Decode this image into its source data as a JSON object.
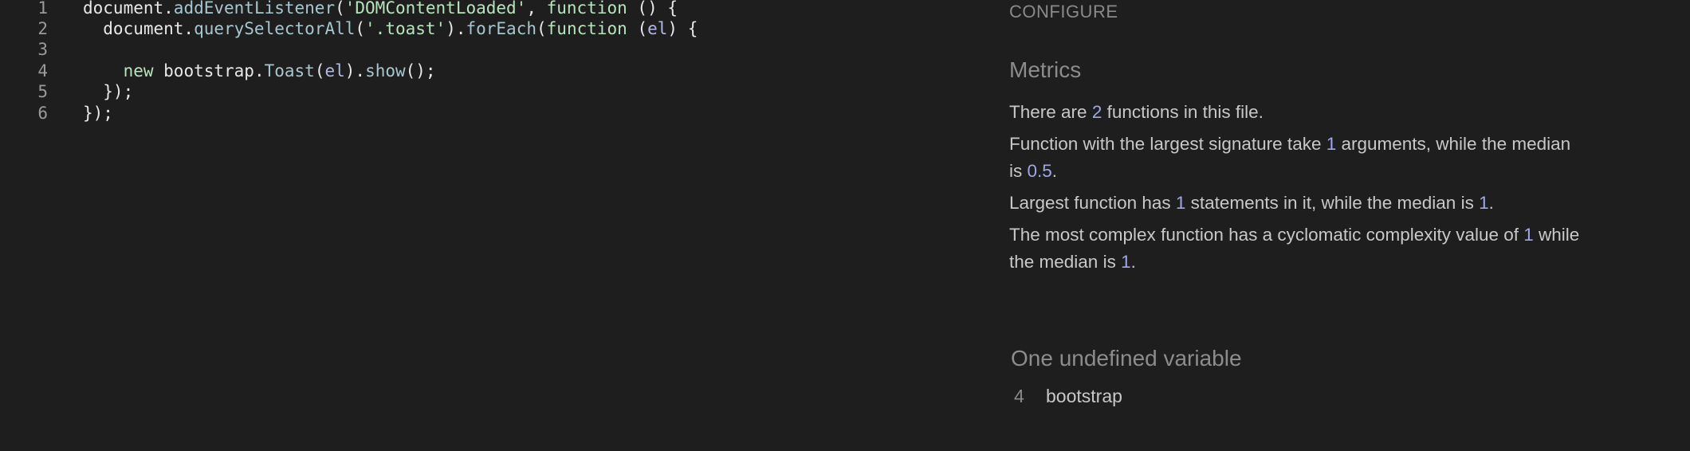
{
  "editor": {
    "lines": [
      {
        "num": "1",
        "tokens": [
          {
            "t": "document.",
            "c": "p"
          },
          {
            "t": "addEventListener",
            "c": "fn"
          },
          {
            "t": "(",
            "c": "p"
          },
          {
            "t": "'DOMContentLoaded'",
            "c": "str"
          },
          {
            "t": ", ",
            "c": "p"
          },
          {
            "t": "function",
            "c": "kw"
          },
          {
            "t": " () {",
            "c": "p"
          }
        ]
      },
      {
        "num": "2",
        "tokens": [
          {
            "t": "  document.",
            "c": "p"
          },
          {
            "t": "querySelectorAll",
            "c": "fn"
          },
          {
            "t": "(",
            "c": "p"
          },
          {
            "t": "'.toast'",
            "c": "str"
          },
          {
            "t": ").",
            "c": "p"
          },
          {
            "t": "forEach",
            "c": "fn"
          },
          {
            "t": "(",
            "c": "p"
          },
          {
            "t": "function",
            "c": "kw"
          },
          {
            "t": " (",
            "c": "p"
          },
          {
            "t": "el",
            "c": "var"
          },
          {
            "t": ") {",
            "c": "p"
          }
        ]
      },
      {
        "num": "3",
        "tokens": []
      },
      {
        "num": "4",
        "tokens": [
          {
            "t": "    ",
            "c": "p"
          },
          {
            "t": "new",
            "c": "kw"
          },
          {
            "t": " bootstrap.",
            "c": "p"
          },
          {
            "t": "Toast",
            "c": "fn"
          },
          {
            "t": "(",
            "c": "p"
          },
          {
            "t": "el",
            "c": "var"
          },
          {
            "t": ").",
            "c": "p"
          },
          {
            "t": "show",
            "c": "fn"
          },
          {
            "t": "();",
            "c": "p"
          }
        ]
      },
      {
        "num": "5",
        "tokens": [
          {
            "t": "  });",
            "c": "p"
          }
        ]
      },
      {
        "num": "6",
        "tokens": [
          {
            "t": "});",
            "c": "p"
          }
        ]
      }
    ]
  },
  "panel": {
    "configure": "CONFIGURE",
    "metrics_title": "Metrics",
    "metrics": [
      [
        {
          "t": "There are "
        },
        {
          "t": "2",
          "n": true
        },
        {
          "t": " functions in this file."
        }
      ],
      [
        {
          "t": "Function with the largest signature take "
        },
        {
          "t": "1",
          "n": true
        },
        {
          "t": " arguments, while the median is "
        },
        {
          "t": "0.5",
          "n": true
        },
        {
          "t": "."
        }
      ],
      [
        {
          "t": "Largest function has "
        },
        {
          "t": "1",
          "n": true
        },
        {
          "t": " statements in it, while the median is "
        },
        {
          "t": "1",
          "n": true
        },
        {
          "t": "."
        }
      ],
      [
        {
          "t": "The most complex function has a cyclomatic complexity value of "
        },
        {
          "t": "1",
          "n": true
        },
        {
          "t": " while the median is "
        },
        {
          "t": "1",
          "n": true
        },
        {
          "t": "."
        }
      ]
    ],
    "undefined_title": "One undefined variable",
    "undefined_vars": [
      {
        "line": "4",
        "name": "bootstrap"
      }
    ]
  },
  "colors": {
    "background": "#1e1e1e",
    "number_highlight": "#9ea8e8",
    "string": "#b7e3bd"
  }
}
